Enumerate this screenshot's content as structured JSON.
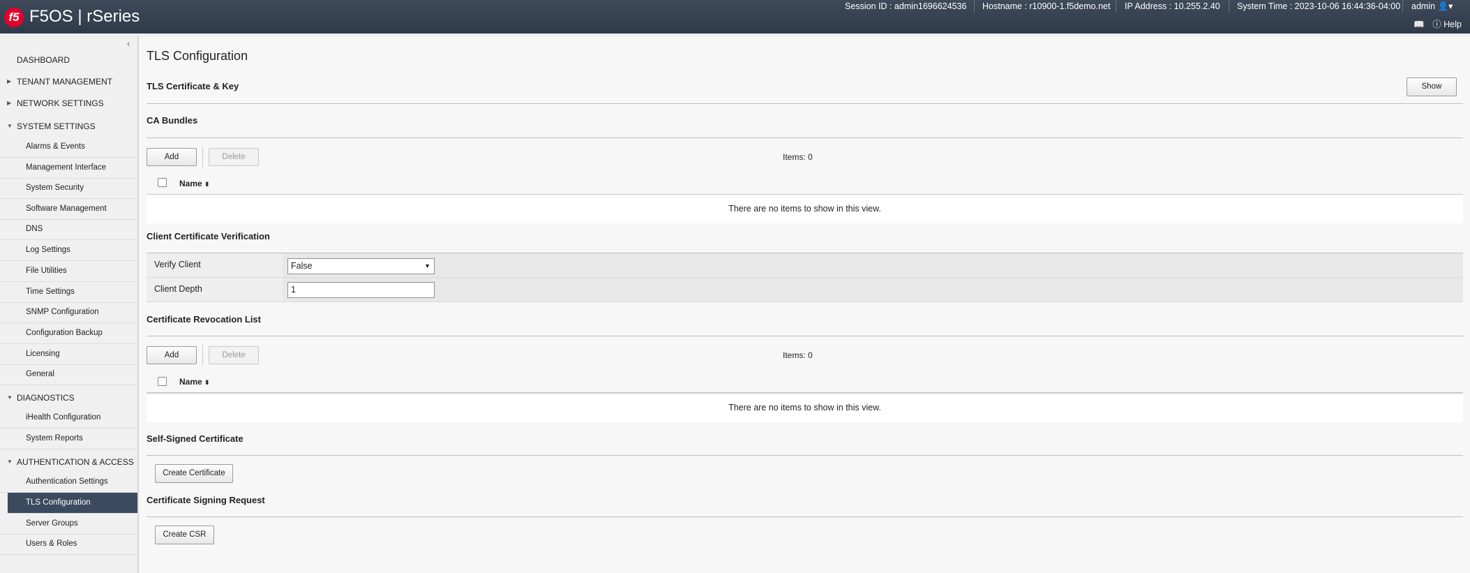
{
  "header": {
    "logo": "f5",
    "app_title": "F5OS | rSeries",
    "session": "Session ID : admin1696624536",
    "hostname": "Hostname : r10900-1.f5demo.net",
    "ip": "IP Address : 10.255.2.40",
    "time": "System Time : 2023-10-06 16:44:36-04:00",
    "user": "admin",
    "help": "Help"
  },
  "sidebar": {
    "dashboard": "DASHBOARD",
    "tenant": "TENANT MANAGEMENT",
    "network": "NETWORK SETTINGS",
    "system": "SYSTEM SETTINGS",
    "system_items": [
      "Alarms & Events",
      "Management Interface",
      "System Security",
      "Software Management",
      "DNS",
      "Log Settings",
      "File Utilities",
      "Time Settings",
      "SNMP Configuration",
      "Configuration Backup",
      "Licensing",
      "General"
    ],
    "diagnostics": "DIAGNOSTICS",
    "diag_items": [
      "iHealth Configuration",
      "System Reports"
    ],
    "auth": "AUTHENTICATION & ACCESS",
    "auth_items": [
      "Authentication Settings",
      "TLS Configuration",
      "Server Groups",
      "Users & Roles"
    ]
  },
  "main": {
    "title": "TLS Configuration",
    "tls_cert": {
      "heading": "TLS Certificate & Key",
      "show_label": "Show"
    },
    "ca_bundles": {
      "heading": "CA Bundles",
      "add": "Add",
      "delete": "Delete",
      "items": "Items: 0",
      "col_name": "Name",
      "empty": "There are no items to show in this view."
    },
    "client_verify": {
      "heading": "Client Certificate Verification",
      "verify_label": "Verify Client",
      "verify_value": "False",
      "depth_label": "Client Depth",
      "depth_value": "1"
    },
    "crl": {
      "heading": "Certificate Revocation List",
      "add": "Add",
      "delete": "Delete",
      "items": "Items: 0",
      "col_name": "Name",
      "empty": "There are no items to show in this view."
    },
    "self_signed": {
      "heading": "Self-Signed Certificate",
      "button": "Create Certificate"
    },
    "csr": {
      "heading": "Certificate Signing Request",
      "button": "Create CSR"
    }
  }
}
